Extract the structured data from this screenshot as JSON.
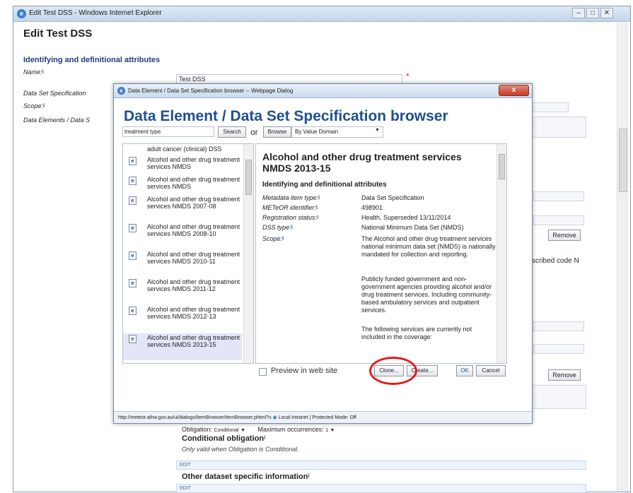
{
  "outer_window": {
    "title": "Edit Test DSS - Windows Internet Explorer",
    "page_title": "Edit Test DSS",
    "section_heading": "Identifying and definitional attributes",
    "labels": {
      "name": "Name:",
      "dss": "Data Set Specification",
      "scope": "Scope:",
      "data_elements": "Data Elements / Data S"
    },
    "info_glyph": "i",
    "name_value": "Test DSS",
    "required_marker": "*",
    "remove_label": "Remove",
    "described_code": "scribed code N",
    "obligation": "Obligation:",
    "obligation_value": "Conditional",
    "max_occurrences": "Maximum occurrences:",
    "max_value": "1",
    "conditional_heading": "Conditional obligation",
    "conditional_note": "Only valid when Obligation is Conditional.",
    "edit_label": "EDIT",
    "other_heading": "Other dataset specific information"
  },
  "dialog": {
    "title": "Data Element / Data Set Specification browser -- Webpage Dialog",
    "close_glyph": "x",
    "heading": "Data Element / Data Set Specification browser",
    "search_value": "treatment type",
    "search_button": "Search",
    "or_label": "or",
    "browse_button": "Browse",
    "browse_select": "By Value Domain",
    "results": [
      {
        "text": "adult cancer (clinical) DSS",
        "icon": "dss-document-icon",
        "has_icon": false
      },
      {
        "text": "Alcohol and other drug treatment services NMDS",
        "icon": "dss-document-icon",
        "has_icon": true
      },
      {
        "text": "Alcohol and other drug treatment services NMDS",
        "icon": "dss-document-icon",
        "has_icon": true
      },
      {
        "text": "Alcohol and other drug treatment services NMDS 2007-08",
        "icon": "dss-document-icon",
        "has_icon": true
      },
      {
        "text": "Alcohol and other drug treatment services NMDS 2008-10",
        "icon": "dss-document-icon",
        "has_icon": true
      },
      {
        "text": "Alcohol and other drug treatment services NMDS 2010-11",
        "icon": "dss-document-icon",
        "has_icon": true
      },
      {
        "text": "Alcohol and other drug treatment services NMDS 2011-12",
        "icon": "dss-document-icon",
        "has_icon": true
      },
      {
        "text": "Alcohol and other drug treatment services NMDS 2012-13",
        "icon": "dss-document-icon",
        "has_icon": true
      },
      {
        "text": "Alcohol and other drug treatment services NMDS 2013-15",
        "icon": "dss-document-icon",
        "has_icon": true,
        "selected": true
      }
    ],
    "detail": {
      "title": "Alcohol and other drug treatment services NMDS 2013-15",
      "section": "Identifying and definitional attributes",
      "rows": [
        {
          "label": "Metadata item type:",
          "value": "Data Set Specification"
        },
        {
          "label": "METeOR identifier:",
          "value": "498901"
        },
        {
          "label": "Registration status:",
          "value": "Health, Superseded 13/11/2014"
        },
        {
          "label": "DSS type:",
          "value": "National Minimum Data Set (NMDS)"
        },
        {
          "label": "Scope:",
          "value": "The Alcohol and other drug treatment services national minimum data set (NMDS) is nationally mandated for collection and reporting."
        }
      ],
      "scope_para2": "Publicly funded government and non-government agencies providing alcohol and/or drug treatment services. Including community-based ambulatory services and outpatient services.",
      "scope_para3": "The following services are currently not included in the coverage:"
    },
    "preview_label": "Preview in web site",
    "buttons": {
      "clone": "Clone...",
      "create": "Create...",
      "ok": "OK",
      "cancel": "Cancel"
    },
    "status": "http://meteor.aihw.gov.au/ui/dialogs/itemBrowser/itemBrowser.phtml?s",
    "status_zone": "Local intranet | Protected Mode: Off"
  },
  "colors": {
    "heading_blue": "#1f4f8f",
    "highlight_red": "#e01d1d",
    "selected_row": "#e2e6f8"
  }
}
